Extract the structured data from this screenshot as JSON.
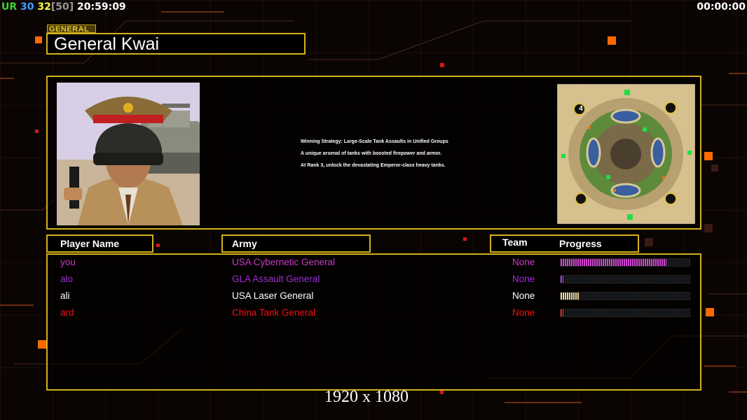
{
  "hud": {
    "ur_label": "UR",
    "stat_a": "30",
    "stat_b": "32",
    "stat_c": "[50]",
    "clock": "20:59:09",
    "timer": "00:00:00"
  },
  "general": {
    "tag": "GENERAL",
    "name": "General Kwai",
    "strategy_lines": [
      "Winning Strategy: Large-Scale Tank Assaults in Unified Groups",
      "A unique arsenal of tanks with boosted firepower and armor.",
      "At Rank 3, unlock the devastating Emperor-class heavy tanks."
    ]
  },
  "minimap": {
    "player_count_badge": "4"
  },
  "table": {
    "headers": {
      "player_name": "Player Name",
      "army": "Army",
      "team": "Team",
      "progress": "Progress"
    },
    "rows": [
      {
        "name": "you",
        "army": "USA Cybernetic General",
        "team": "None",
        "progress": 0.82,
        "color": "#c43bc4",
        "fill": "#d248d2"
      },
      {
        "name": "alo",
        "army": "GLA Assault General",
        "team": "None",
        "progress": 0.02,
        "color": "#9a2fd0",
        "fill": "#a040e0"
      },
      {
        "name": "ali",
        "army": "USA Laser General",
        "team": "None",
        "progress": 0.14,
        "color": "#ffffff",
        "fill": "#e8d8a0"
      },
      {
        "name": "ard",
        "army": "China Tank General",
        "team": "None",
        "progress": 0.02,
        "color": "#ee1111",
        "fill": "#ee2222"
      }
    ]
  },
  "footer": {
    "resolution": "1920 x 1080"
  },
  "colors": {
    "frame": "#d4b01c",
    "accent_orange": "#ff6a00"
  }
}
